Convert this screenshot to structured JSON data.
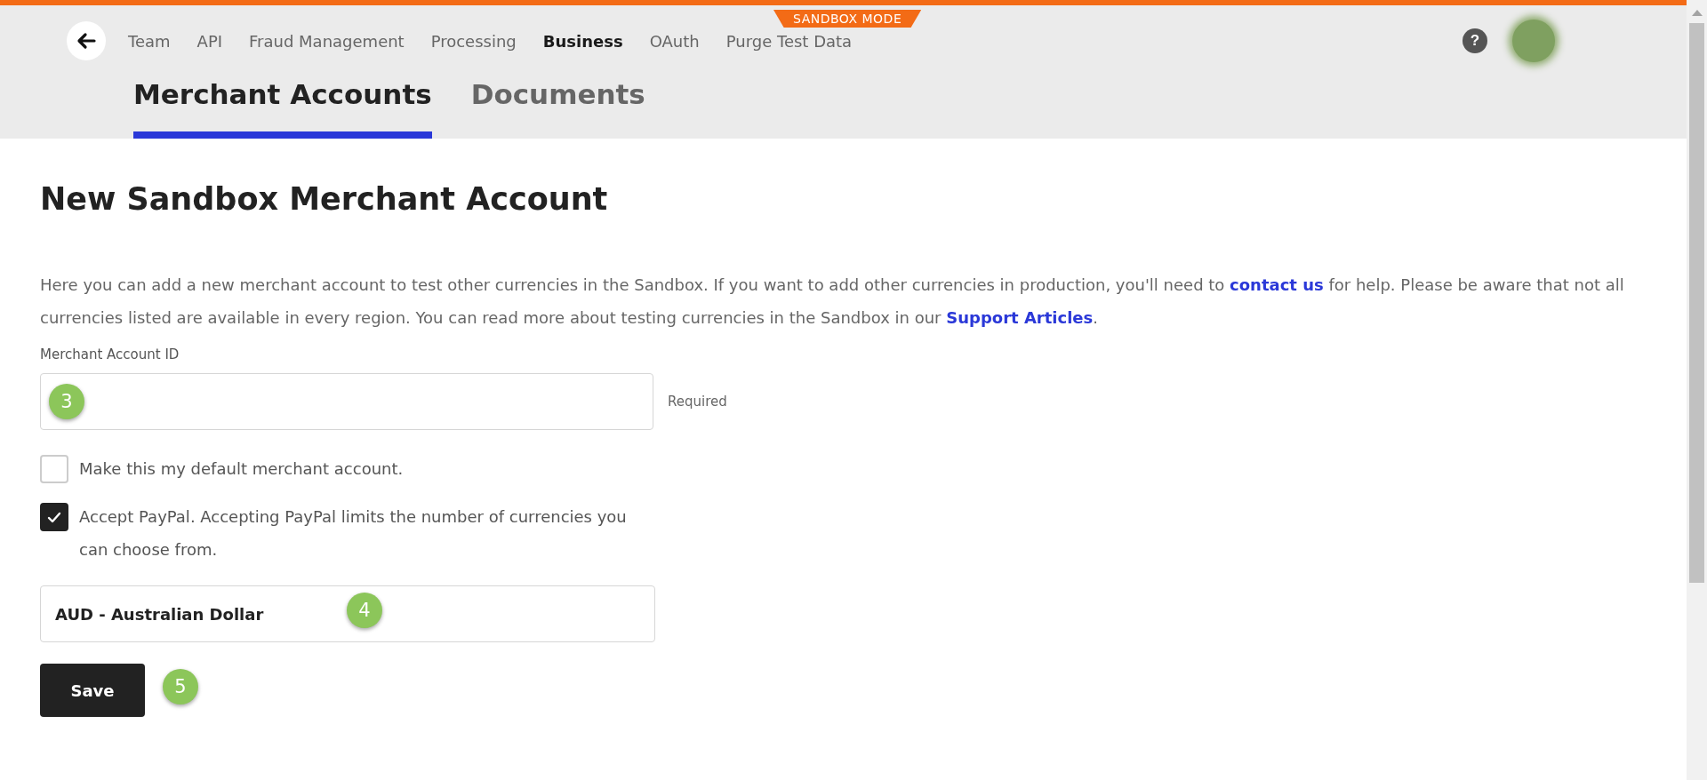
{
  "banner": "SANDBOX MODE",
  "nav": [
    {
      "label": "Team",
      "selected": false
    },
    {
      "label": "API",
      "selected": false
    },
    {
      "label": "Fraud Management",
      "selected": false
    },
    {
      "label": "Processing",
      "selected": false
    },
    {
      "label": "Business",
      "selected": true
    },
    {
      "label": "OAuth",
      "selected": false
    },
    {
      "label": "Purge Test Data",
      "selected": false
    }
  ],
  "help": "?",
  "tabs": [
    {
      "label": "Merchant Accounts",
      "selected": true
    },
    {
      "label": "Documents",
      "selected": false
    }
  ],
  "title": "New Sandbox Merchant Account",
  "intro": [
    {
      "kind": "text",
      "text": "Here you can add a new merchant account to test other currencies in the Sandbox. If you want to add other currencies in production, you'll need to"
    },
    {
      "kind": "link",
      "text": "contact us"
    },
    {
      "kind": "text",
      "text": "for help. Please be aware that not all currencies listed are available in every region. You can read more about testing currencies in the Sandbox in our"
    },
    {
      "kind": "link",
      "text": "Support Articles"
    },
    {
      "kind": "text",
      "text": "."
    }
  ],
  "field": {
    "label": "Merchant Account ID",
    "hint": "Required",
    "callout": "3"
  },
  "checkboxes": [
    {
      "label": "Make this my default merchant account.",
      "checked": false
    },
    {
      "label": "Accept PayPal. Accepting PayPal limits the number of currencies you can choose from.",
      "checked": true
    }
  ],
  "currency": {
    "value": "AUD - Australian Dollar",
    "callout": "4"
  },
  "save": {
    "label": "Save",
    "callout": "5"
  }
}
